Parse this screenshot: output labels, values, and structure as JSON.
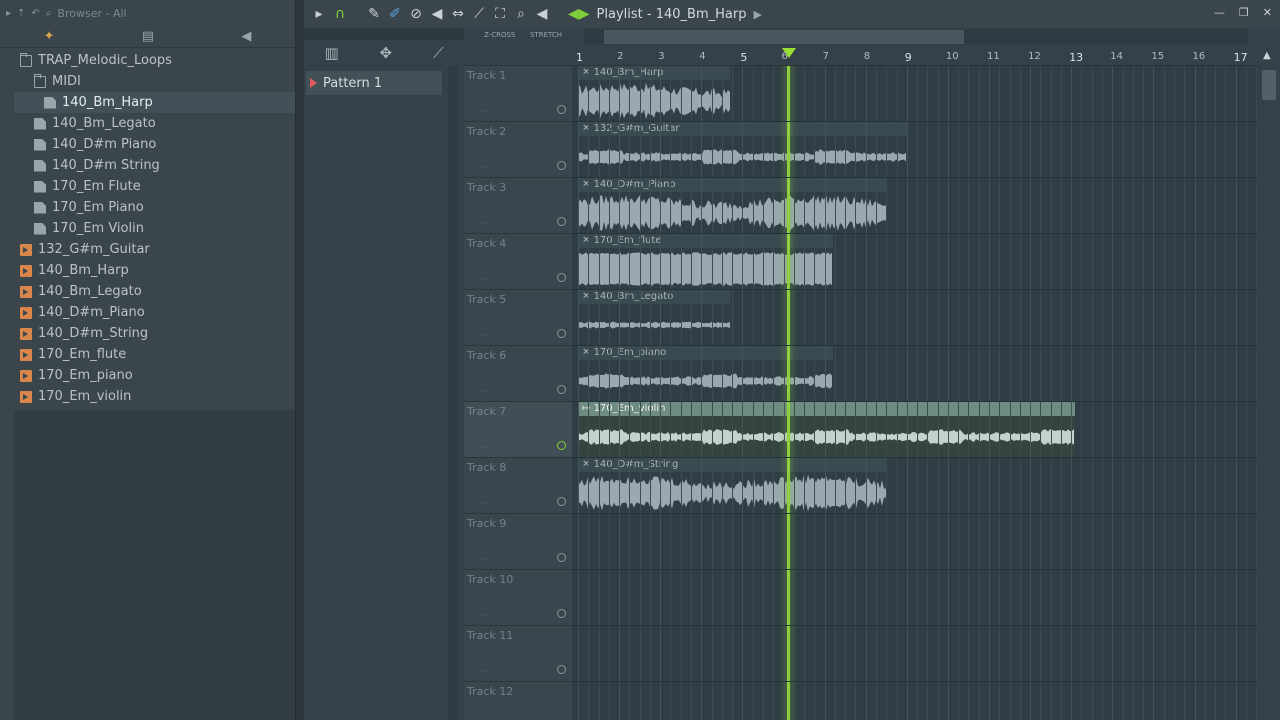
{
  "browser": {
    "header_label": "Browser - All",
    "tree": [
      {
        "label": "TRAP_Melodic_Loops",
        "type": "folder",
        "indent": 0
      },
      {
        "label": "MIDI",
        "type": "folder",
        "indent": 1
      },
      {
        "label": "140_Bm_Harp",
        "type": "file",
        "indent": 2,
        "selected": true
      },
      {
        "label": "140_Bm_Legato",
        "type": "file",
        "indent": 1
      },
      {
        "label": "140_D#m Piano",
        "type": "file",
        "indent": 1
      },
      {
        "label": "140_D#m String",
        "type": "file",
        "indent": 1
      },
      {
        "label": "170_Em Flute",
        "type": "file",
        "indent": 1
      },
      {
        "label": "170_Em Piano",
        "type": "file",
        "indent": 1
      },
      {
        "label": "170_Em Violin",
        "type": "file",
        "indent": 1
      },
      {
        "label": "132_G#m_Guitar",
        "type": "audio",
        "indent": 0
      },
      {
        "label": "140_Bm_Harp",
        "type": "audio",
        "indent": 0
      },
      {
        "label": "140_Bm_Legato",
        "type": "audio",
        "indent": 0
      },
      {
        "label": "140_D#m_Piano",
        "type": "audio",
        "indent": 0
      },
      {
        "label": "140_D#m_String",
        "type": "audio",
        "indent": 0
      },
      {
        "label": "170_Em_flute",
        "type": "audio",
        "indent": 0
      },
      {
        "label": "170_Em_piano",
        "type": "audio",
        "indent": 0
      },
      {
        "label": "170_Em_violin",
        "type": "audio",
        "indent": 0
      }
    ]
  },
  "picker": {
    "pattern_label": "Pattern 1"
  },
  "toolbar": {
    "title": "Playlist - 140_Bm_Harp"
  },
  "subbar": {
    "zcross_label": "Z-CROSS",
    "stretch_label": "STRETCH"
  },
  "ruler": {
    "bars": [
      "1",
      "2",
      "3",
      "4",
      "5",
      "6",
      "7",
      "8",
      "9",
      "10",
      "11",
      "12",
      "13",
      "14",
      "15",
      "16",
      "17"
    ],
    "playhead_bar": 6.1
  },
  "tracks": [
    {
      "name": "Track 1"
    },
    {
      "name": "Track 2"
    },
    {
      "name": "Track 3"
    },
    {
      "name": "Track 4"
    },
    {
      "name": "Track 5"
    },
    {
      "name": "Track 6"
    },
    {
      "name": "Track 7"
    },
    {
      "name": "Track 8"
    },
    {
      "name": "Track 9"
    },
    {
      "name": "Track 10"
    },
    {
      "name": "Track 11"
    },
    {
      "name": "Track 12"
    }
  ],
  "clips": [
    {
      "track": 0,
      "start_bar": 1,
      "end_bar": 4.7,
      "name": "140_Bm_Harp",
      "wave": "dense"
    },
    {
      "track": 1,
      "start_bar": 1,
      "end_bar": 9.0,
      "name": "132_G#m_Guitar",
      "wave": "thin"
    },
    {
      "track": 2,
      "start_bar": 1,
      "end_bar": 8.5,
      "name": "140_D#m_Piano",
      "wave": "dense"
    },
    {
      "track": 3,
      "start_bar": 1,
      "end_bar": 7.2,
      "name": "170_Em_flute",
      "wave": "block"
    },
    {
      "track": 4,
      "start_bar": 1,
      "end_bar": 4.7,
      "name": "140_Bm_Legato",
      "wave": "line"
    },
    {
      "track": 5,
      "start_bar": 1,
      "end_bar": 7.2,
      "name": "170_Em_piano",
      "wave": "thin"
    },
    {
      "track": 6,
      "start_bar": 1,
      "end_bar": 13.1,
      "name": "170_Em_violin",
      "wave": "thin",
      "active": true
    },
    {
      "track": 7,
      "start_bar": 1,
      "end_bar": 8.5,
      "name": "140_D#m_String",
      "wave": "dense"
    }
  ],
  "colors": {
    "playhead": "#8ed13b",
    "wave": "#9aa9b0",
    "accent_green": "#7fd03a"
  }
}
